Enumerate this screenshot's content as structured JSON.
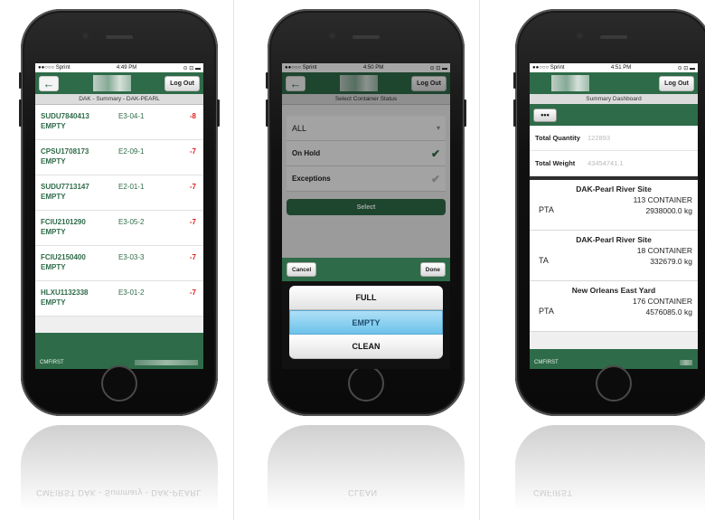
{
  "phone1": {
    "status": {
      "carrier": "●●○○○ Sprint",
      "time": "4:49 PM",
      "icons": "⊙ ⊡ ▬"
    },
    "header": {
      "back_icon": "arrow-left-icon",
      "logout_label": "Log Out"
    },
    "subtitle": "DAK - Summary - DAK-PEARL",
    "items": [
      {
        "id": "SUDU7840413",
        "status": "EMPTY",
        "location": "E3-04-1",
        "value": "-8"
      },
      {
        "id": "CPSU1708173",
        "status": "EMPTY",
        "location": "E2-09-1",
        "value": "-7"
      },
      {
        "id": "SUDU7713147",
        "status": "EMPTY",
        "location": "E2-01-1",
        "value": "-7"
      },
      {
        "id": "FCIU2101290",
        "status": "EMPTY",
        "location": "E3-05-2",
        "value": "-7"
      },
      {
        "id": "FCIU2150400",
        "status": "EMPTY",
        "location": "E3-03-3",
        "value": "-7"
      },
      {
        "id": "HLXU1132338",
        "status": "EMPTY",
        "location": "E3-01-2",
        "value": "-7"
      }
    ],
    "footer_brand": "CMFIRST"
  },
  "phone2": {
    "status": {
      "carrier": "●●○○○ Sprint",
      "time": "4:50 PM",
      "icons": "⊙ ⊡ ▬"
    },
    "header": {
      "logout_label": "Log Out"
    },
    "subtitle": "Select Container Status",
    "options": {
      "all": "ALL",
      "on_hold": "On Hold",
      "exceptions": "Exceptions"
    },
    "select_label": "Select",
    "cancel_label": "Cancel",
    "done_label": "Done",
    "picker": [
      "FULL",
      "EMPTY",
      "CLEAN"
    ]
  },
  "phone3": {
    "status": {
      "carrier": "●●○○○ Sprint",
      "time": "4:51 PM",
      "icons": "⊙ ⊡ ▬"
    },
    "header": {
      "logout_label": "Log Out"
    },
    "subtitle": "Summary Dashboard",
    "menu_label": "•••",
    "totals": [
      {
        "label": "Total Quantity",
        "value": "122893"
      },
      {
        "label": "Total Weight",
        "value": "43454741.1"
      }
    ],
    "sites": [
      {
        "name": "DAK-Pearl River Site",
        "code": "PTA",
        "quantity": "113 CONTAINER",
        "weight": "2938000.0 kg"
      },
      {
        "name": "DAK-Pearl River Site",
        "code": "TA",
        "quantity": "18 CONTAINER",
        "weight": "332679.0 kg"
      },
      {
        "name": "New Orleans East Yard",
        "code": "PTA",
        "quantity": "176 CONTAINER",
        "weight": "4576085.0 kg"
      }
    ],
    "footer_brand": "CMFIRST"
  },
  "reflections": {
    "r1": "CMFIRST        DAK - Summary - DAK-PEARL",
    "r2": "CLEAN",
    "r3": "CMFIRST"
  },
  "colors": {
    "accent": "#2e6b48",
    "negative": "#e02020",
    "picker_selected": "#6cc2ea"
  }
}
